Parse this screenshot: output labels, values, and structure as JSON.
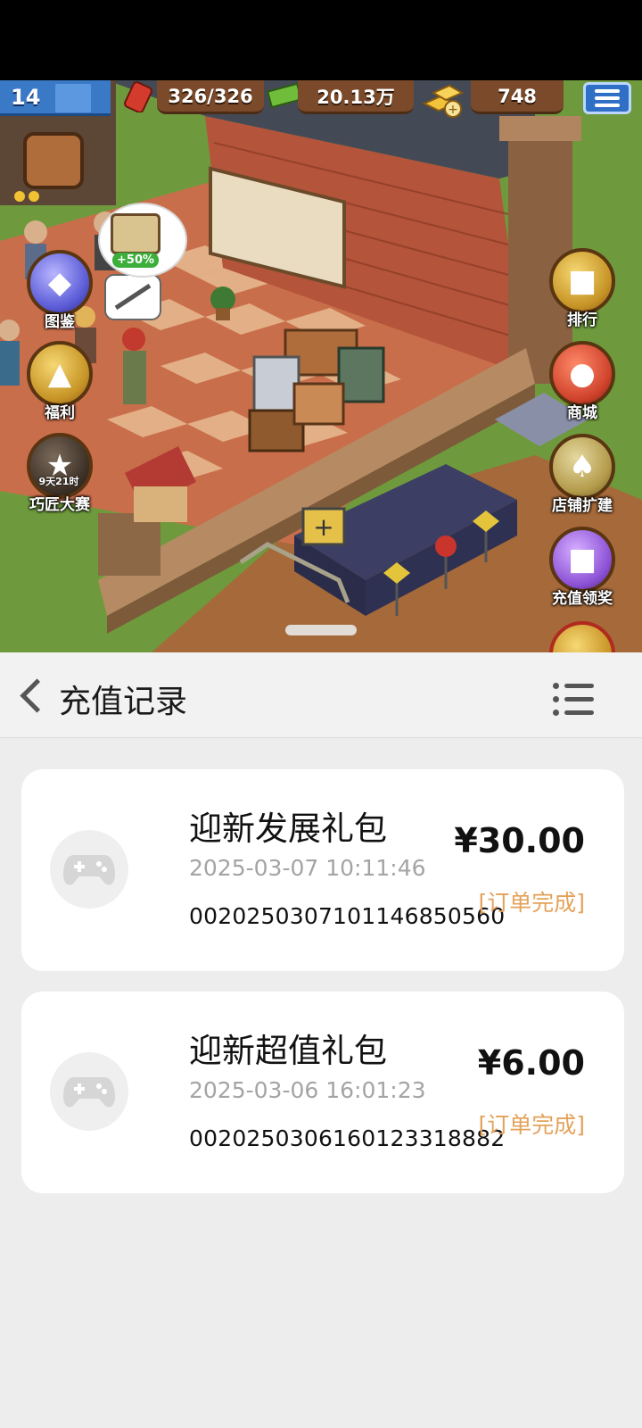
{
  "game": {
    "hud": {
      "level": "14",
      "energy": "326/326",
      "cash": "20.13万",
      "gold": "748"
    },
    "bubble_bonus": "+50%",
    "left_buttons": [
      {
        "label": "图鉴",
        "icon": "book-icon"
      },
      {
        "label": "福利",
        "icon": "gold-chest-icon"
      },
      {
        "label": "巧匠大赛",
        "icon": "trophy-icon",
        "timer": "9天21时"
      }
    ],
    "right_buttons": [
      {
        "label": "排行",
        "icon": "podium-icon"
      },
      {
        "label": "商城",
        "icon": "cart-icon"
      },
      {
        "label": "店铺扩建",
        "icon": "shovel-icon"
      },
      {
        "label": "充值领奖",
        "icon": "gift-icon"
      }
    ]
  },
  "header": {
    "title": "充值记录",
    "back_icon": "chevron-left-icon",
    "menu_icon": "list-icon"
  },
  "orders": [
    {
      "name": "迎新发展礼包",
      "time": "2025-03-07 10:11:46",
      "order_no": "0020250307101146850560",
      "price": "¥30.00",
      "status": "[订单完成]",
      "icon": "gamepad-icon"
    },
    {
      "name": "迎新超值礼包",
      "time": "2025-03-06 16:01:23",
      "order_no": "0020250306160123318882",
      "price": "¥6.00",
      "status": "[订单完成]",
      "icon": "gamepad-icon"
    }
  ],
  "colors": {
    "status_complete": "#e3a25a",
    "page_bg": "#ededed",
    "card_bg": "#ffffff"
  }
}
